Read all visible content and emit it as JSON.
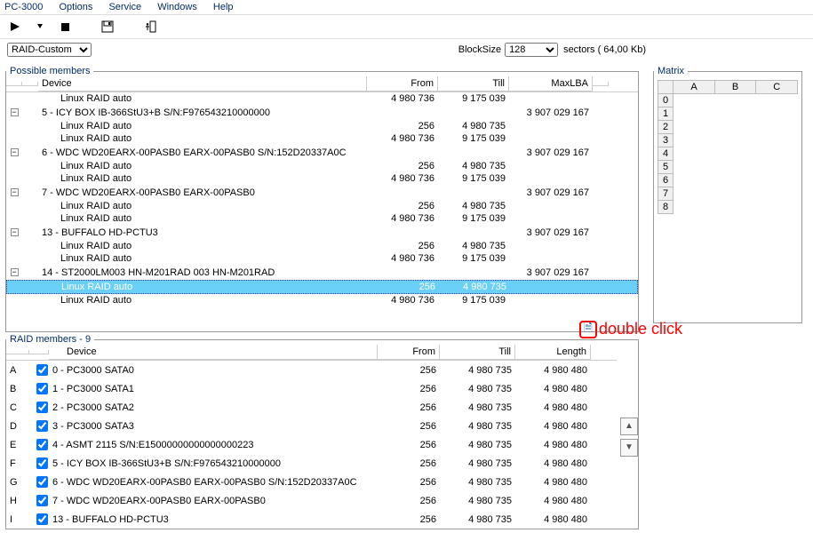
{
  "app_title": "PC-3000",
  "menu": [
    "Options",
    "Service",
    "Windows",
    "Help"
  ],
  "raid_type": "RAID-Custom",
  "blocksize_label": "BlockSize",
  "blocksize_value": "128",
  "blocksize_suffix": "sectors ( 64,00 Kb)",
  "possible": {
    "legend": "Possible members",
    "headers": {
      "device": "Device",
      "from": "From",
      "till": "Till",
      "maxlba": "MaxLBA"
    },
    "rows": [
      {
        "type": "child",
        "name": "Linux RAID auto",
        "from": "4 980 736",
        "till": "9 175 039"
      },
      {
        "type": "parent",
        "name": "5 - ICY BOX IB-366StU3+B S/N:F976543210000000",
        "maxlba": "3 907 029 167"
      },
      {
        "type": "child",
        "name": "Linux RAID auto",
        "from": "256",
        "till": "4 980 735"
      },
      {
        "type": "child",
        "name": "Linux RAID auto",
        "from": "4 980 736",
        "till": "9 175 039"
      },
      {
        "type": "parent",
        "name": "6 - WDC WD20EARX-00PASB0 EARX-00PASB0 S/N:152D20337A0C",
        "maxlba": "3 907 029 167"
      },
      {
        "type": "child",
        "name": "Linux RAID auto",
        "from": "256",
        "till": "4 980 735"
      },
      {
        "type": "child",
        "name": "Linux RAID auto",
        "from": "4 980 736",
        "till": "9 175 039"
      },
      {
        "type": "parent",
        "name": "7 - WDC WD20EARX-00PASB0 EARX-00PASB0",
        "maxlba": "3 907 029 167"
      },
      {
        "type": "child",
        "name": "Linux RAID auto",
        "from": "256",
        "till": "4 980 735"
      },
      {
        "type": "child",
        "name": "Linux RAID auto",
        "from": "4 980 736",
        "till": "9 175 039"
      },
      {
        "type": "parent",
        "name": "13 - BUFFALO HD-PCTU3",
        "maxlba": "3 907 029 167"
      },
      {
        "type": "child",
        "name": "Linux RAID auto",
        "from": "256",
        "till": "4 980 735"
      },
      {
        "type": "child",
        "name": "Linux RAID auto",
        "from": "4 980 736",
        "till": "9 175 039"
      },
      {
        "type": "parent",
        "name": "14 - ST2000LM003 HN-M201RAD 003 HN-M201RAD",
        "maxlba": "3 907 029 167"
      },
      {
        "type": "child",
        "name": "Linux RAID auto",
        "from": "256",
        "till": "4 980 735",
        "selected": true
      },
      {
        "type": "child",
        "name": "Linux RAID auto",
        "from": "4 980 736",
        "till": "9 175 039"
      }
    ]
  },
  "members": {
    "legend": "RAID members - 9",
    "headers": {
      "device": "Device",
      "from": "From",
      "till": "Till",
      "length": "Length"
    },
    "rows": [
      {
        "letter": "A",
        "name": "0 - PC3000 SATA0",
        "from": "256",
        "till": "4 980 735",
        "length": "4 980 480"
      },
      {
        "letter": "B",
        "name": "1 - PC3000 SATA1",
        "from": "256",
        "till": "4 980 735",
        "length": "4 980 480"
      },
      {
        "letter": "C",
        "name": "2 - PC3000 SATA2",
        "from": "256",
        "till": "4 980 735",
        "length": "4 980 480"
      },
      {
        "letter": "D",
        "name": "3 - PC3000 SATA3",
        "from": "256",
        "till": "4 980 735",
        "length": "4 980 480"
      },
      {
        "letter": "E",
        "name": "4 - ASMT 2115 S/N:E15000000000000000223",
        "from": "256",
        "till": "4 980 735",
        "length": "4 980 480"
      },
      {
        "letter": "F",
        "name": "5 - ICY BOX IB-366StU3+B S/N:F976543210000000",
        "from": "256",
        "till": "4 980 735",
        "length": "4 980 480"
      },
      {
        "letter": "G",
        "name": "6 - WDC WD20EARX-00PASB0 EARX-00PASB0 S/N:152D20337A0C",
        "from": "256",
        "till": "4 980 735",
        "length": "4 980 480"
      },
      {
        "letter": "H",
        "name": "7 - WDC WD20EARX-00PASB0 EARX-00PASB0",
        "from": "256",
        "till": "4 980 735",
        "length": "4 980 480"
      },
      {
        "letter": "I",
        "name": "13 - BUFFALO HD-PCTU3",
        "from": "256",
        "till": "4 980 735",
        "length": "4 980 480"
      }
    ]
  },
  "matrix": {
    "legend": "Matrix",
    "cols": [
      "A",
      "B",
      "C"
    ],
    "rows": [
      "0",
      "1",
      "2",
      "3",
      "4",
      "5",
      "6",
      "7",
      "8"
    ]
  },
  "annotation": {
    "text": "double click"
  }
}
